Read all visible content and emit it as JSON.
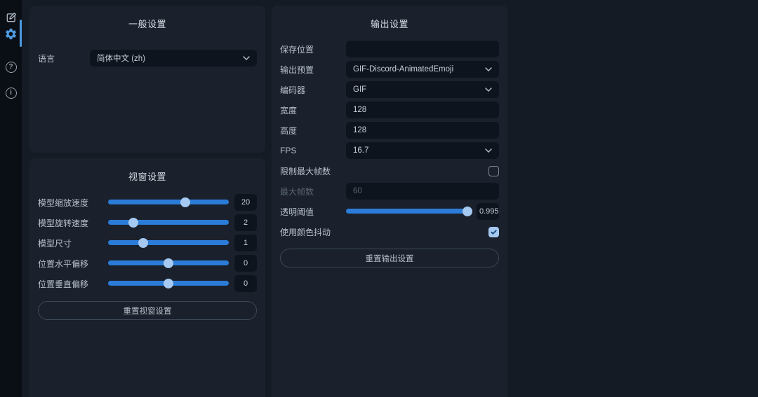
{
  "theme": {
    "background": "#151b25",
    "sidebar_background": "#0a0e15",
    "panel_background": "#1a212c",
    "field_background": "#0e141d",
    "accent_blue": "#2b7cd9",
    "slider_thumb": "#a5c9f1",
    "active_icon": "#4e9be0",
    "text_primary": "#c7d0d9",
    "text_label": "#b7c1cb",
    "text_disabled": "#586270"
  },
  "sidebar": {
    "items": [
      {
        "id": "edit",
        "icon": "edit-icon",
        "active": false
      },
      {
        "id": "settings",
        "icon": "gear-icon",
        "active": true
      },
      {
        "id": "help",
        "icon": "help-icon",
        "glyph": "?",
        "active": false
      },
      {
        "id": "info",
        "icon": "info-icon",
        "glyph": "i",
        "active": false
      }
    ]
  },
  "general_panel": {
    "title": "一般设置",
    "language_label": "语言",
    "language_value": "简体中文 (zh)"
  },
  "viewport_panel": {
    "title": "视窗设置",
    "sliders": [
      {
        "label": "模型缩放速度",
        "value": "20",
        "percent": 64
      },
      {
        "label": "模型旋转速度",
        "value": "2",
        "percent": 21
      },
      {
        "label": "模型尺寸",
        "value": "1",
        "percent": 29
      },
      {
        "label": "位置水平偏移",
        "value": "0",
        "percent": 50
      },
      {
        "label": "位置垂直偏移",
        "value": "0",
        "percent": 50
      }
    ],
    "reset_label": "重置视窗设置"
  },
  "output_panel": {
    "title": "输出设置",
    "rows": {
      "save_location": {
        "label": "保存位置",
        "value": ""
      },
      "preset": {
        "label": "输出预置",
        "value": "GIF-Discord-AnimatedEmoji"
      },
      "encoder": {
        "label": "编码器",
        "value": "GIF"
      },
      "width": {
        "label": "宽度",
        "value": "128"
      },
      "height": {
        "label": "高度",
        "value": "128"
      },
      "fps": {
        "label": "FPS",
        "value": "16.7"
      },
      "limit_max_frames": {
        "label": "限制最大帧数",
        "checked": false
      },
      "max_frames": {
        "label": "最大帧数",
        "value": "60",
        "disabled": true
      },
      "alpha_threshold": {
        "label": "透明阈值",
        "value": "0.995",
        "percent": 97
      },
      "color_dither": {
        "label": "使用颜色抖动",
        "checked": true
      }
    },
    "reset_label": "重置输出设置"
  }
}
